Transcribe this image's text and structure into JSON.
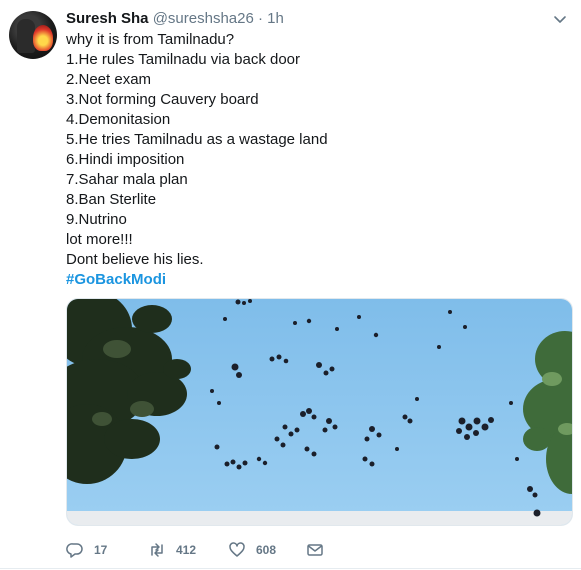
{
  "tweet": {
    "author_name": "Suresh Sha",
    "author_handle": "@sureshsha26",
    "separator": "·",
    "timestamp": "1h",
    "lines": [
      "why it is from Tamilnadu?",
      "1.He rules Tamilnadu via back door",
      "2.Neet exam",
      "3.Not forming Cauvery board",
      "4.Demonitasion",
      "5.He tries Tamilnadu as a wastage land",
      "6.Hindi imposition",
      "7.Sahar mala plan",
      "8.Ban Sterlite",
      "9.Nutrino",
      "lot more!!!",
      "Dont believe his lies."
    ],
    "hashtag": "#GoBackModi"
  },
  "actions": {
    "reply_count": "17",
    "retweet_count": "412",
    "like_count": "608"
  },
  "icons": {
    "menu": "chevron-down-icon",
    "reply": "reply-icon",
    "retweet": "retweet-icon",
    "like": "heart-icon",
    "message": "envelope-icon"
  },
  "colors": {
    "name": "#14171a",
    "secondary": "#657786",
    "hashtag": "#1b95e0",
    "sky": "#8ec6ee"
  }
}
